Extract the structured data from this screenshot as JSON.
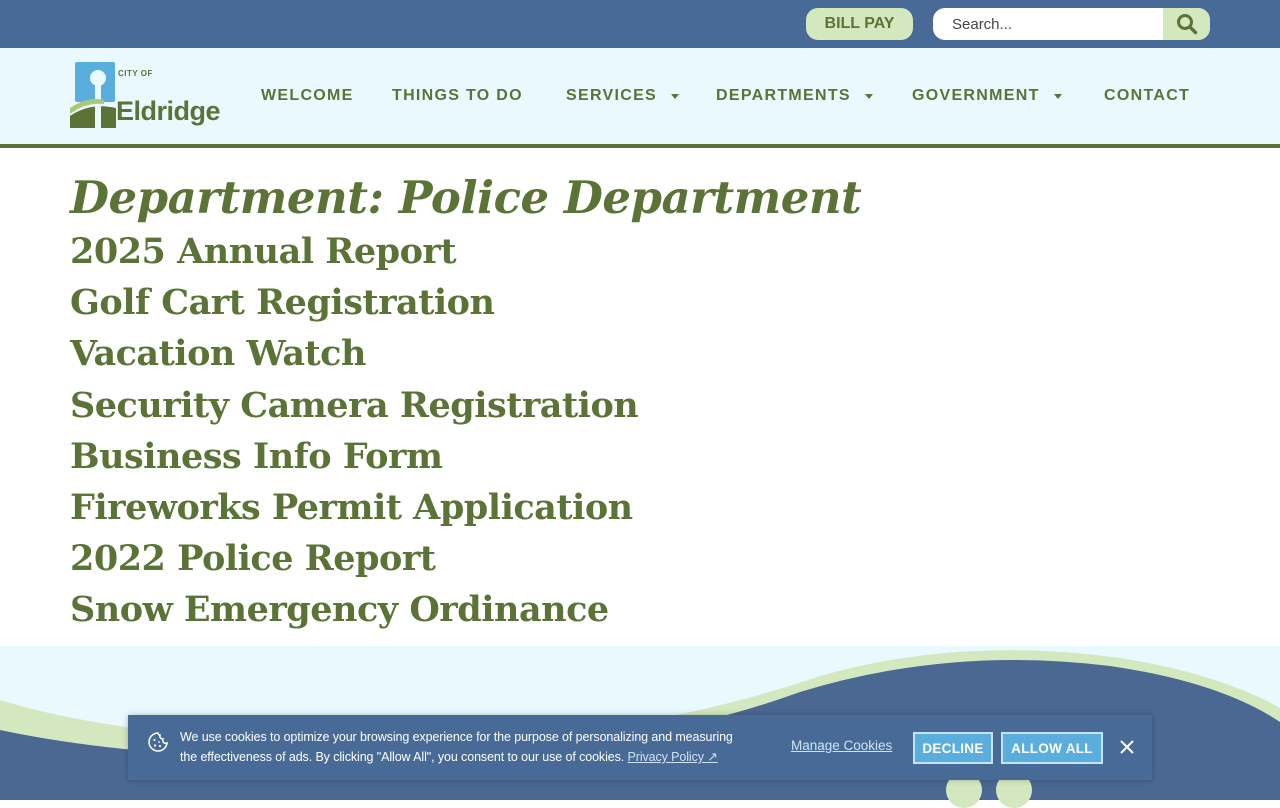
{
  "topbar": {
    "bill_pay_label": "BILL PAY",
    "search_placeholder": "Search...",
    "search_icon": "search-icon"
  },
  "header": {
    "logo": {
      "small_text": "CITY OF",
      "big_text": "Eldridge"
    },
    "nav": [
      {
        "label": "WELCOME",
        "has_dropdown": false
      },
      {
        "label": "THINGS TO DO",
        "has_dropdown": false
      },
      {
        "label": "SERVICES",
        "has_dropdown": true
      },
      {
        "label": "DEPARTMENTS",
        "has_dropdown": true
      },
      {
        "label": "GOVERNMENT",
        "has_dropdown": true
      },
      {
        "label": "CONTACT",
        "has_dropdown": false
      }
    ]
  },
  "main": {
    "title": "Department: Police Department",
    "links": [
      "2025 Annual Report",
      "Golf Cart Registration",
      "Vacation Watch",
      "Security Camera Registration",
      "Business Info Form",
      "Fireworks Permit Application",
      "2022 Police Report",
      "Snow Emergency Ordinance"
    ]
  },
  "cookie_banner": {
    "text_line1": "We use cookies to optimize your browsing experience for the purpose of personalizing and measuring",
    "text_line2": "the effectiveness of ads. By clicking \"Allow All\", you consent to our use of cookies.",
    "privacy_link": "Privacy Policy ↗",
    "manage_label": "Manage Cookies",
    "decline_label": "DECLINE",
    "allow_label": "ALLOW ALL",
    "icons": [
      "cookie-icon",
      "close-icon"
    ]
  },
  "colors": {
    "topbar": "#476a96",
    "header_bg": "#e9f9fd",
    "brand_green": "#5b7336",
    "light_green": "#d4e8c0",
    "cookie_button": "#5aaede"
  }
}
